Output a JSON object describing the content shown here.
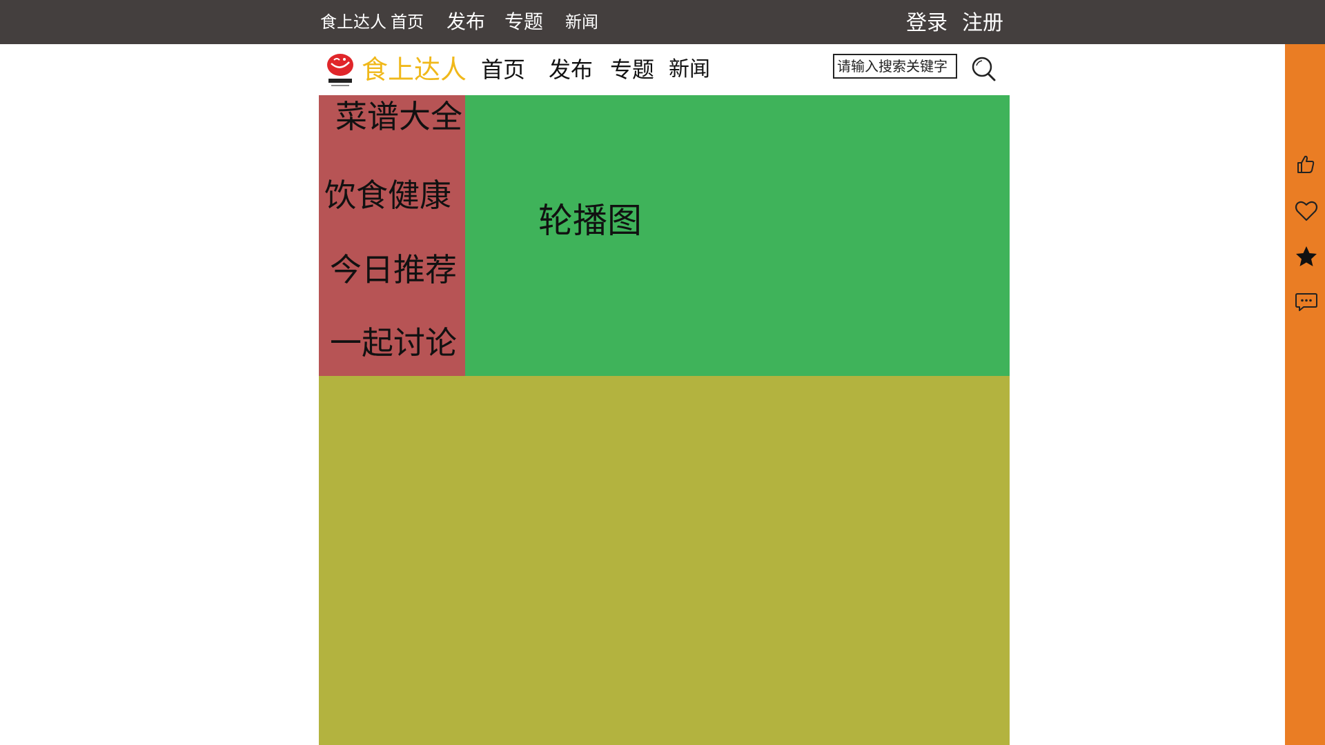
{
  "topbar": {
    "brand": "食上达人",
    "home": "首页",
    "publish": "发布",
    "topics": "专题",
    "news": "新闻",
    "login": "登录",
    "register": "注册"
  },
  "navbar": {
    "logo_icon": "food-master-logo",
    "brand": "食上达人",
    "home": "首页",
    "publish": "发布",
    "topics": "专题",
    "news": "新闻",
    "search_placeholder": "请输入搜索关键字",
    "search_icon": "search-icon"
  },
  "sidebar": {
    "items": [
      {
        "label": "菜谱大全"
      },
      {
        "label": "饮食健康"
      },
      {
        "label": "今日推荐"
      },
      {
        "label": "一起讨论"
      }
    ]
  },
  "carousel": {
    "label": "轮播图"
  },
  "side_rail": {
    "icons": [
      "thumbs-up-icon",
      "heart-icon",
      "star-icon",
      "chat-icon"
    ]
  },
  "colors": {
    "topbar_bg": "#443f3e",
    "brand_yellow": "#f0b81a",
    "sidebar_bg": "#b75455",
    "carousel_bg": "#3fb35a",
    "content_bg": "#b3b33f",
    "rail_bg": "#ea7d24"
  }
}
